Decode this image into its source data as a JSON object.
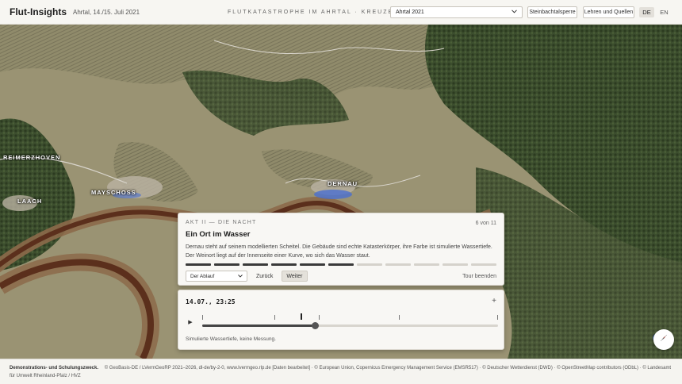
{
  "header": {
    "brand": "Flut-Insights",
    "subtitle": "Ahrtal, 14./15. Juli 2021",
    "title": "Flutkatastrophe im Ahrtal · Kreuzberg – Kripp",
    "event_select": "Ahrtal 2021",
    "btn_dam": "Steinbachtalsperre",
    "btn_lessons": "Lehren und Quellen",
    "lang_de": "DE",
    "lang_en": "EN"
  },
  "map": {
    "places": {
      "reimerzhoven": "Reimerzhoven",
      "laach": "Laach",
      "mayschoss": "Mayschoß",
      "dernau": "Dernau"
    }
  },
  "tour": {
    "act": "Akt II — Die Nacht",
    "count": "6 von 11",
    "title": "Ein Ort im Wasser",
    "text": "Dernau steht auf seinem modellierten Scheitel. Die Gebäude sind echte Katasterkörper, ihre Farbe ist simulierte Wassertiefe. Der Weinort liegt auf der Innenseite einer Kurve, wo sich das Wasser staut.",
    "step_current": 6,
    "step_total": 11,
    "chapter_select": "Der Ablauf",
    "btn_back": "Zurück",
    "btn_next": "Weiter",
    "btn_end": "Tour beenden"
  },
  "timeline": {
    "time": "14.07., 23:25",
    "progress": 0.38,
    "note": "Simulierte Wassertiefe, keine Messung."
  },
  "footer": {
    "disclaimer": "Demonstrations- und Schulungszweck.",
    "credits": "© GeoBasis-DE / LVermGeoRP 2021–2026, dl-de/by-2-0, www.lvermgeo.rlp.de [Daten bearbeitet] · © European Union, Copernicus Emergency Management Service (EMSR517) · © Deutscher Wetterdienst (DWD) · © OpenStreetMap contributors (ODbL) · © Landesamt für Umwelt Rheinland-Pfalz / HVZ"
  },
  "colors": {
    "water_deep": "#5b2f1c",
    "water_mid": "#8c6a4a",
    "flood_blue": "#4a6fd0",
    "forest": "#37492a",
    "fields": "#9a9373"
  }
}
